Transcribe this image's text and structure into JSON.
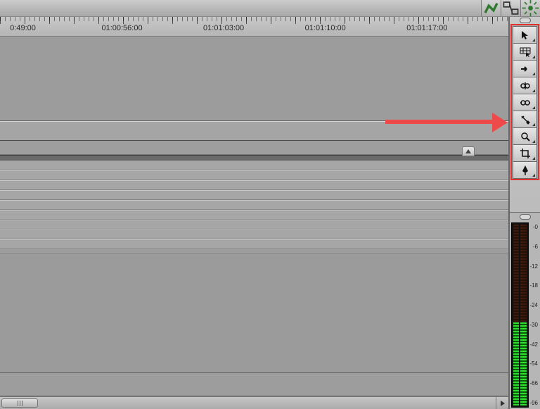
{
  "titlebar_icons": [
    "fx-green-a",
    "fx-links",
    "fx-sparkle"
  ],
  "ruler": {
    "labels": [
      {
        "text": "0:49:00",
        "xpct": 4.5
      },
      {
        "text": "01:00:56:00",
        "xpct": 24
      },
      {
        "text": "01:01:03:00",
        "xpct": 44
      },
      {
        "text": "01:01:10:00",
        "xpct": 64
      },
      {
        "text": "01:01:17:00",
        "xpct": 84
      }
    ],
    "major_tick_spacing_px": 35,
    "minor_tick_spacing_px": 7
  },
  "tools": [
    {
      "name": "selection-tool",
      "icon": "cursor"
    },
    {
      "name": "edit-selection-tool",
      "icon": "grid-cursor"
    },
    {
      "name": "select-track-fwd-tool",
      "icon": "arrow-right"
    },
    {
      "name": "ripple-tool",
      "icon": "ripple"
    },
    {
      "name": "slip-tool",
      "icon": "slip"
    },
    {
      "name": "razor-tool",
      "icon": "razor"
    },
    {
      "name": "zoom-tool",
      "icon": "magnifier"
    },
    {
      "name": "crop-tool",
      "icon": "crop"
    },
    {
      "name": "pen-tool",
      "icon": "pen"
    }
  ],
  "meter_scale": [
    "-0",
    "-6",
    "-12",
    "-18",
    "-24",
    "-30",
    "-42",
    "-54",
    "-66",
    "-96"
  ],
  "tracks": {
    "video_track_count": 3,
    "audio_lane_count": 9
  },
  "annotation": {
    "points_to": "tool-panel"
  }
}
